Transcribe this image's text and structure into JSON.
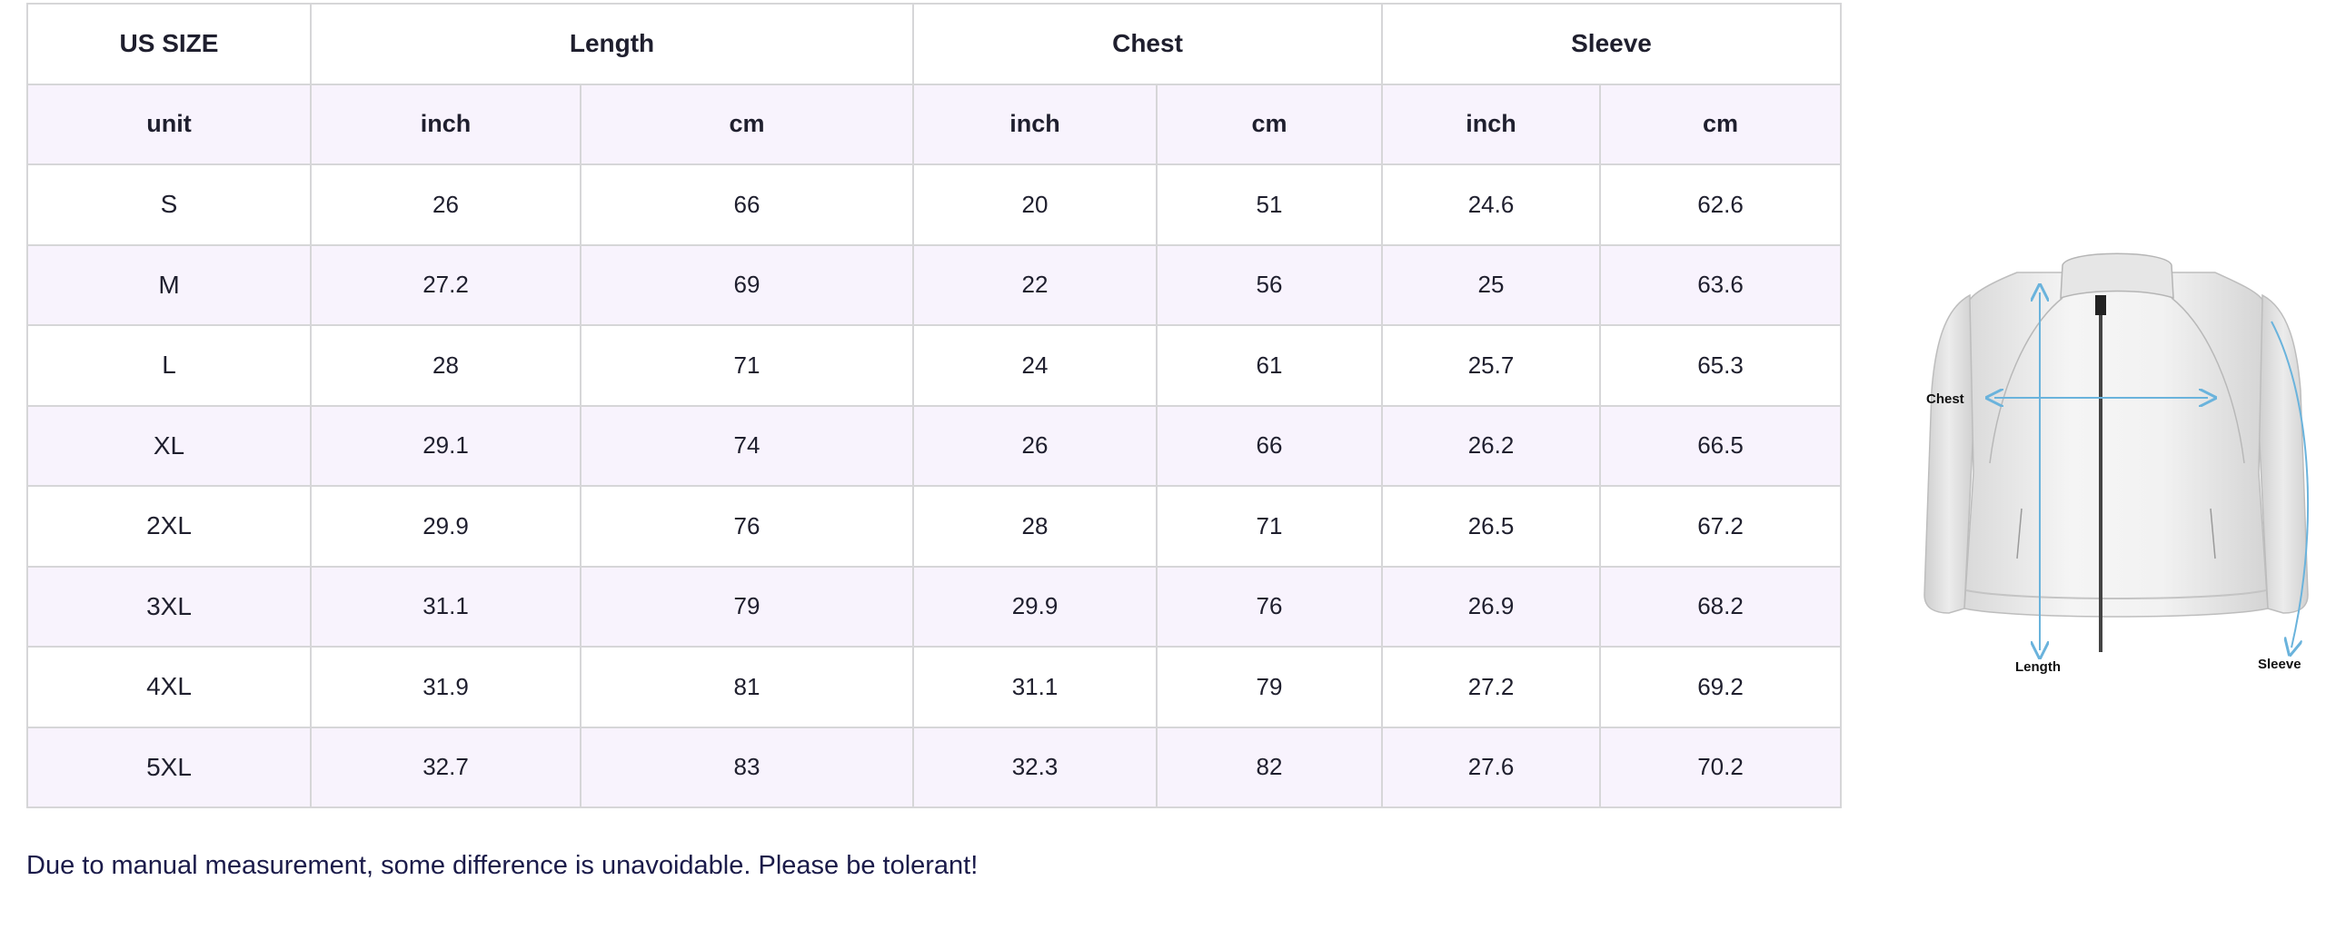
{
  "table": {
    "header": {
      "size": "US SIZE",
      "length": "Length",
      "chest": "Chest",
      "sleeve": "Sleeve"
    },
    "units": [
      "unit",
      "inch",
      "cm",
      "inch",
      "cm",
      "inch",
      "cm"
    ],
    "rows": [
      [
        "S",
        "26",
        "66",
        "20",
        "51",
        "24.6",
        "62.6"
      ],
      [
        "M",
        "27.2",
        "69",
        "22",
        "56",
        "25",
        "63.6"
      ],
      [
        "L",
        "28",
        "71",
        "24",
        "61",
        "25.7",
        "65.3"
      ],
      [
        "XL",
        "29.1",
        "74",
        "26",
        "66",
        "26.2",
        "66.5"
      ],
      [
        "2XL",
        "29.9",
        "76",
        "28",
        "71",
        "26.5",
        "67.2"
      ],
      [
        "3XL",
        "31.1",
        "79",
        "29.9",
        "76",
        "26.9",
        "68.2"
      ],
      [
        "4XL",
        "31.9",
        "81",
        "31.1",
        "79",
        "27.2",
        "69.2"
      ],
      [
        "5XL",
        "32.7",
        "83",
        "32.3",
        "82",
        "27.6",
        "70.2"
      ]
    ]
  },
  "note": "Due to manual measurement, some difference is unavoidable. Please be tolerant!",
  "diagram": {
    "chest_label": "Chest",
    "length_label": "Length",
    "sleeve_label": "Sleeve",
    "measure_color": "#6ab3dc"
  }
}
